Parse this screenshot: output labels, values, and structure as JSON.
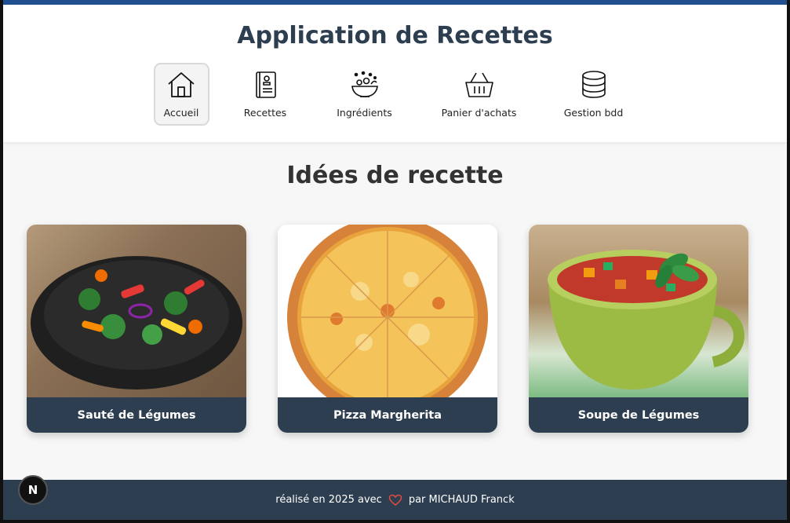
{
  "header": {
    "title": "Application de Recettes"
  },
  "nav": {
    "items": [
      {
        "label": "Accueil",
        "icon": "home-icon",
        "active": true
      },
      {
        "label": "Recettes",
        "icon": "recipe-book-icon"
      },
      {
        "label": "Ingrédients",
        "icon": "ingredients-bowl-icon"
      },
      {
        "label": "Panier d'achats",
        "icon": "shopping-basket-icon"
      },
      {
        "label": "Gestion bdd",
        "icon": "database-icon"
      }
    ]
  },
  "main": {
    "section_title": "Idées de recette",
    "cards": [
      {
        "title": "Sauté de Légumes",
        "image": "vegetable-stir-fry-image"
      },
      {
        "title": "Pizza Margherita",
        "image": "pizza-image"
      },
      {
        "title": "Soupe de Légumes",
        "image": "vegetable-soup-image"
      }
    ]
  },
  "footer": {
    "prefix": "réalisé en 2025 avec",
    "suffix": "par MICHAUD Franck",
    "icon": "heart-icon"
  },
  "dev_badge": {
    "letter": "N"
  },
  "colors": {
    "accent_bar": "#1f4f8f",
    "dark": "#2c3e50",
    "heart": "#e74c3c"
  }
}
